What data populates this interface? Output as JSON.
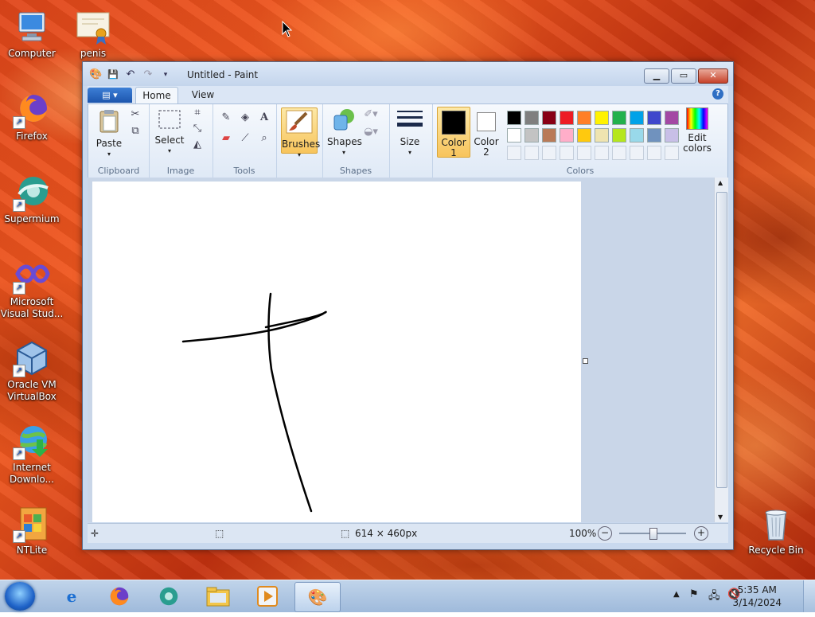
{
  "desktop": {
    "icons": [
      {
        "label": "Computer"
      },
      {
        "label": "penis"
      },
      {
        "label": "Firefox"
      },
      {
        "label": "Supermium"
      },
      {
        "label": "Microsoft Visual Stud..."
      },
      {
        "label": "Oracle VM VirtualBox"
      },
      {
        "label": "Internet Downlo..."
      },
      {
        "label": "NTLite"
      },
      {
        "label": "Recycle Bin"
      }
    ]
  },
  "window": {
    "title": "Untitled - Paint",
    "tabs": [
      {
        "label": "Home"
      },
      {
        "label": "View"
      }
    ],
    "ribbon": {
      "clipboard": {
        "group_label": "Clipboard",
        "paste_label": "Paste"
      },
      "image": {
        "group_label": "Image",
        "select_label": "Select"
      },
      "tools": {
        "group_label": "Tools"
      },
      "brushes": {
        "label": "Brushes"
      },
      "shapes": {
        "group_label": "Shapes",
        "shapes_label": "Shapes"
      },
      "size": {
        "label": "Size"
      },
      "colors": {
        "group_label": "Colors",
        "color1_label": "Color 1",
        "color2_label": "Color 2",
        "edit_label": "Edit colors",
        "color1": "#000000",
        "color2": "#ffffff",
        "palette_row1": [
          "#000000",
          "#7f7f7f",
          "#880015",
          "#ed1c24",
          "#ff7f27",
          "#fff200",
          "#22b14c",
          "#00a2e8",
          "#3f48cc",
          "#a349a4"
        ],
        "palette_row2": [
          "#ffffff",
          "#c3c3c3",
          "#b97a57",
          "#ffaec9",
          "#ffc90e",
          "#efe4b0",
          "#b5e61d",
          "#99d9ea",
          "#7092be",
          "#c8bfe7"
        ]
      }
    },
    "status": {
      "image_size": "614 × 460px",
      "zoom": "100%"
    }
  },
  "taskbar": {
    "time": "5:35 AM",
    "date": "3/14/2024"
  }
}
